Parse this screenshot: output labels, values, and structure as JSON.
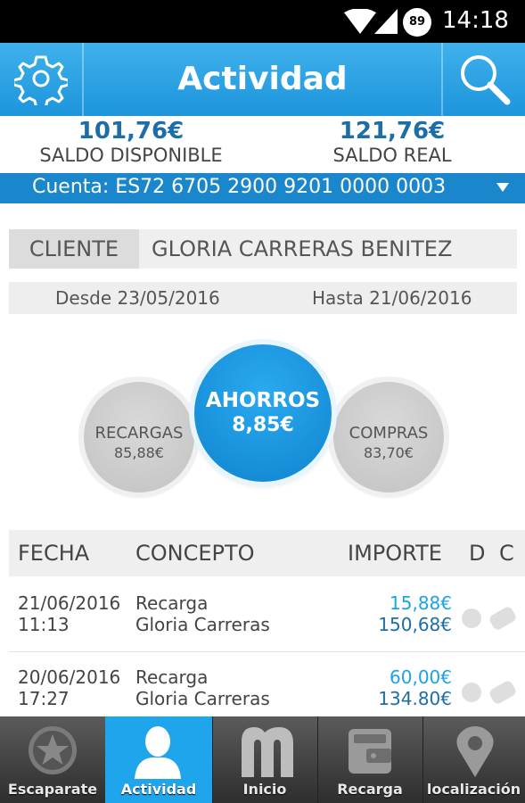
{
  "status_bar": {
    "time": "14:18",
    "battery": "89"
  },
  "header": {
    "title": "Actividad"
  },
  "balances": {
    "available_amount": "101,76€",
    "available_label": "SALDO DISPONIBLE",
    "real_amount": "121,76€",
    "real_label": "SALDO REAL"
  },
  "account": {
    "label": "Cuenta: ES72 6705 2900 9201 0000 0003"
  },
  "client": {
    "label": "CLIENTE",
    "name": "GLORIA CARRERAS BENITEZ"
  },
  "dates": {
    "from": "Desde 23/05/2016",
    "to": "Hasta 21/06/2016"
  },
  "summary": {
    "recargas_label": "RECARGAS",
    "recargas_value": "85,88€",
    "ahorros_label": "AHORROS",
    "ahorros_value": "8,85€",
    "compras_label": "COMPRAS",
    "compras_value": "83,70€"
  },
  "table": {
    "headers": {
      "fecha": "FECHA",
      "concepto": "CONCEPTO",
      "importe": "IMPORTE",
      "d": "D",
      "c": "C"
    },
    "rows": [
      {
        "date": "21/06/2016",
        "time": "11:13",
        "concept": "Recarga",
        "person": "Gloria Carreras",
        "amount": "15,88€",
        "balance": "150,68€"
      },
      {
        "date": "20/06/2016",
        "time": "17:27",
        "concept": "Recarga",
        "person": "Gloria Carreras",
        "amount": "60,00€",
        "balance": "134.80€"
      }
    ]
  },
  "bottom_nav": [
    {
      "label": "Escaparate",
      "icon": "star-badge-icon"
    },
    {
      "label": "Actividad",
      "icon": "user-icon",
      "active": true
    },
    {
      "label": "Inicio",
      "icon": "m-logo-icon"
    },
    {
      "label": "Recarga",
      "icon": "wallet-icon"
    },
    {
      "label": "localización",
      "icon": "location-pin-icon"
    }
  ],
  "colors": {
    "primary": "#1fa5eb",
    "dark_blue": "#1d6da7",
    "nav_bg": "#3a3a3a"
  }
}
